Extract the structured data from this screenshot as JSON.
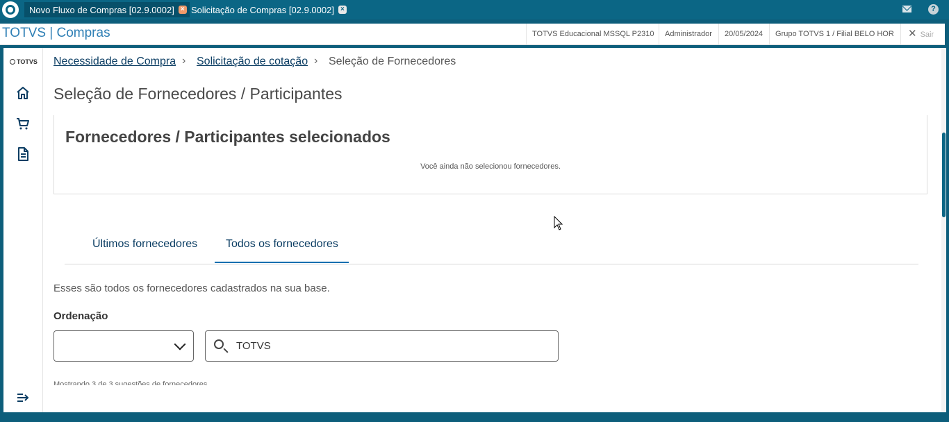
{
  "top_tabs": [
    {
      "label": "Novo Fluxo de Compras [02.9.0002]",
      "active": true
    },
    {
      "label": "Solicitação de Compras [02.9.0002]",
      "active": false
    }
  ],
  "header": {
    "brand": "TOTVS | Compras",
    "environment": "TOTVS Educacional MSSQL P2310",
    "user": "Administrador",
    "date": "20/05/2024",
    "branch": "Grupo TOTVS 1 / Filial BELO HOR",
    "logout": "Sair"
  },
  "sidebar": {
    "logo": "TOTVS",
    "items": [
      "home-icon",
      "cart-icon",
      "document-icon"
    ],
    "collapse": "menu-collapse-icon"
  },
  "breadcrumb": {
    "items": [
      "Necessidade de Compra",
      "Solicitação de cotação",
      "Seleção de Fornecedores"
    ]
  },
  "page_title": "Seleção de Fornecedores / Participantes",
  "selected_card": {
    "title": "Fornecedores / Participantes selecionados",
    "empty_message": "Você ainda não selecionou fornecedores."
  },
  "tabs": [
    {
      "label": "Últimos fornecedores",
      "active": false
    },
    {
      "label": "Todos os fornecedores",
      "active": true
    }
  ],
  "description": "Esses são todos os fornecedores cadastrados na sua base.",
  "ordering": {
    "label": "Ordenação",
    "value": ""
  },
  "search": {
    "value": "TOTVS"
  },
  "showing_text": "Mostrando 3 de 3 sugestões de fornecedores",
  "colors": {
    "primary": "#0b6685",
    "link": "#0b3d63",
    "tab_underline": "#0b6fb0"
  }
}
